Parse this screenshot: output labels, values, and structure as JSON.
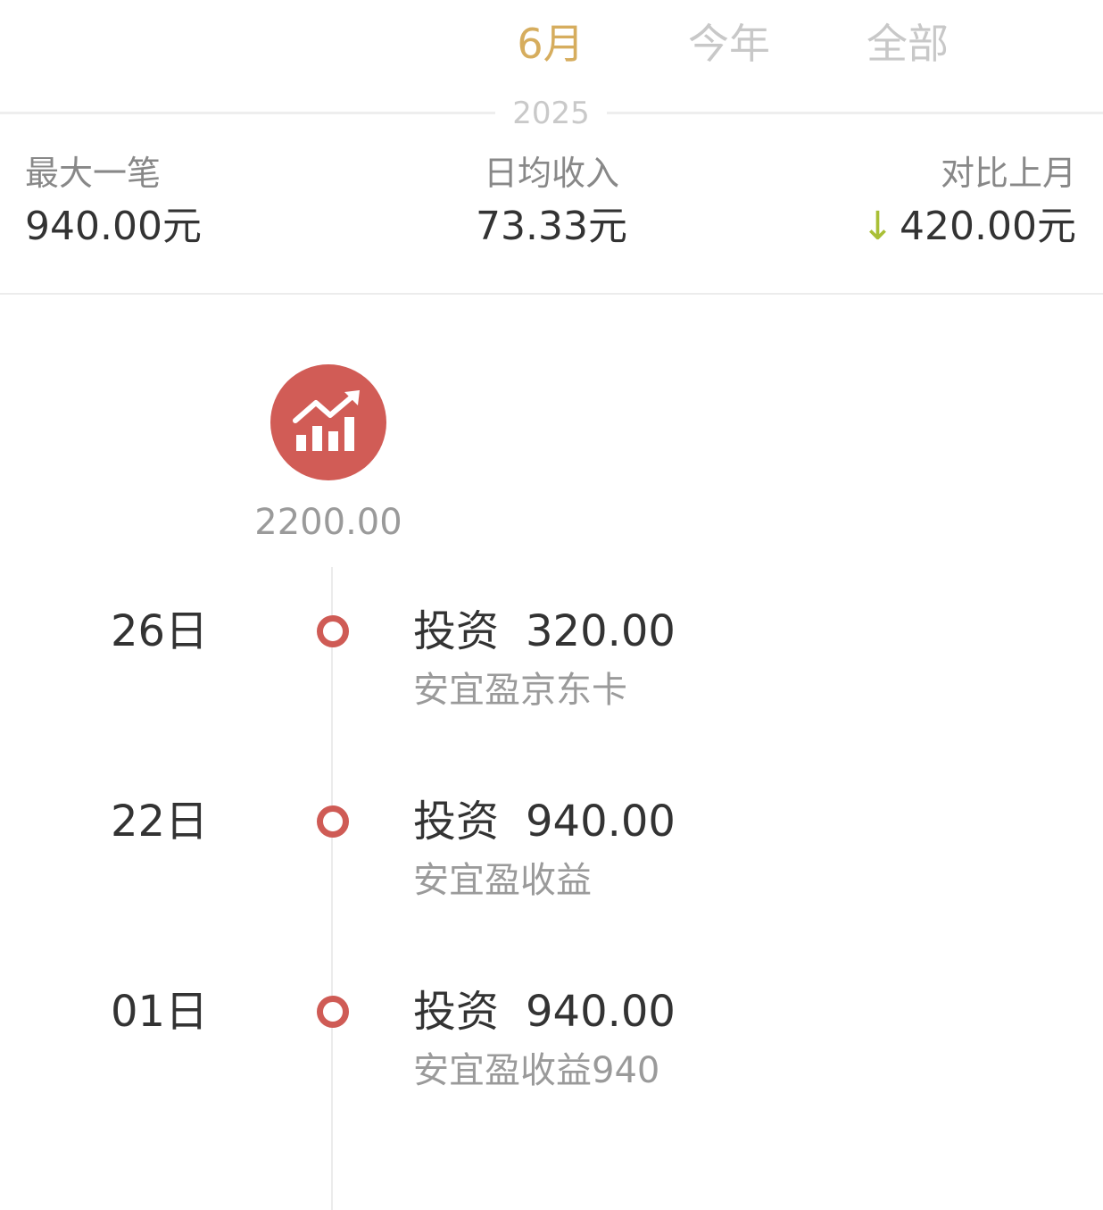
{
  "tabs": {
    "items": [
      {
        "label": "6月",
        "active": true
      },
      {
        "label": "今年",
        "active": false
      },
      {
        "label": "全部",
        "active": false
      }
    ]
  },
  "year": "2025",
  "stats": {
    "max_single": {
      "label": "最大一笔",
      "value": "940.00元"
    },
    "daily_avg": {
      "label": "日均收入",
      "value": "73.33元"
    },
    "vs_last_month": {
      "label": "对比上月",
      "value": "420.00元",
      "direction": "down",
      "arrow_glyph": "↓"
    }
  },
  "category": {
    "icon": "investment-chart-icon",
    "color": "#d15c56",
    "total": "2200.00"
  },
  "entries": [
    {
      "day": "26日",
      "category": "投资",
      "amount": "320.00",
      "note": "安宜盈京东卡"
    },
    {
      "day": "22日",
      "category": "投资",
      "amount": "940.00",
      "note": "安宜盈收益"
    },
    {
      "day": "01日",
      "category": "投资",
      "amount": "940.00",
      "note": "安宜盈收益940"
    }
  ],
  "colors": {
    "accent_gold": "#d6ad5e",
    "timeline_red": "#d15c56",
    "down_green": "#a9bf36"
  }
}
